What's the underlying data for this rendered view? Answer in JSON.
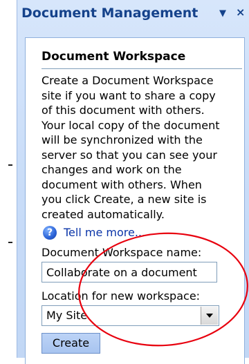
{
  "pane": {
    "title": "Document Management",
    "menu_glyph": "▼",
    "close_glyph": "×"
  },
  "workspace": {
    "heading": "Document Workspace",
    "description": "Create a Document Workspace site if you want to share a copy of this document with others. Your local copy of the document will be synchronized with the server so that you can see your changes and work on the document with others. When you click Create, a new site is created automatically.",
    "help_link": "Tell me more...",
    "name_label": "Document Workspace name:",
    "name_value": "Collaborate on a document",
    "location_label": "Location for new workspace:",
    "location_value": "My Site",
    "create_label": "Create"
  },
  "icons": {
    "help": "help-icon",
    "dropdown": "chevron-down-icon",
    "close": "close-icon"
  },
  "colors": {
    "pane_background": "#c8dcf8",
    "title_text": "#15428b",
    "link_text": "#0b35a8",
    "annotation_ellipse": "#e8000e"
  }
}
